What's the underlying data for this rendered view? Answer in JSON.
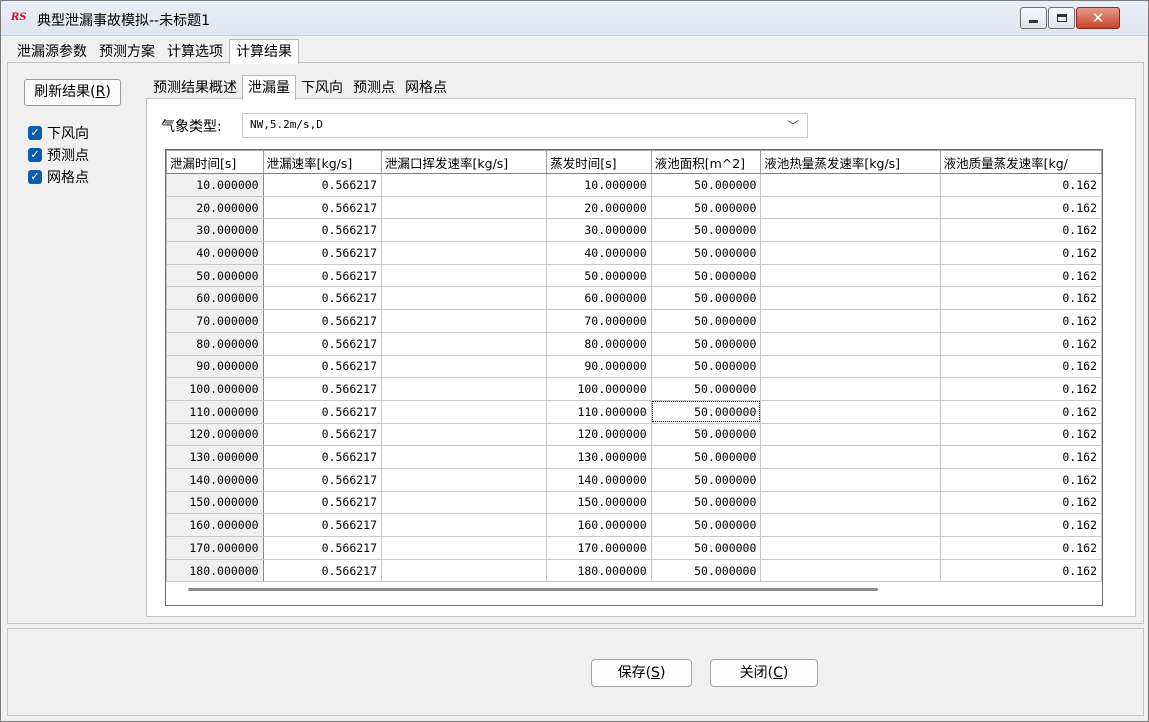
{
  "window": {
    "title": "典型泄漏事故模拟--未标题1",
    "app_icon": "RS"
  },
  "main_tabs": [
    "泄漏源参数",
    "预测方案",
    "计算选项",
    "计算结果"
  ],
  "active_main_tab": "计算结果",
  "left": {
    "refresh_label": "刷新结果(",
    "refresh_mnemonic": "R",
    "refresh_suffix": ")",
    "checkboxes": [
      {
        "label": "下风向",
        "checked": true
      },
      {
        "label": "预测点",
        "checked": true
      },
      {
        "label": "网格点",
        "checked": true
      }
    ]
  },
  "sub_tabs": [
    "预测结果概述",
    "泄漏量",
    "下风向",
    "预测点",
    "网格点"
  ],
  "active_sub_tab": "泄漏量",
  "weather": {
    "label": "气象类型:",
    "value": "NW,5.2m/s,D"
  },
  "table": {
    "headers": [
      "泄漏时间[s]",
      "泄漏速率[kg/s]",
      "泄漏口挥发速率[kg/s]",
      "蒸发时间[s]",
      "液池面积[m^2]",
      "液池热量蒸发速率[kg/s]",
      "液池质量蒸发速率[kg/"
    ],
    "rows": [
      [
        "10.000000",
        "0.566217",
        "",
        "10.000000",
        "50.000000",
        "",
        "0.162"
      ],
      [
        "20.000000",
        "0.566217",
        "",
        "20.000000",
        "50.000000",
        "",
        "0.162"
      ],
      [
        "30.000000",
        "0.566217",
        "",
        "30.000000",
        "50.000000",
        "",
        "0.162"
      ],
      [
        "40.000000",
        "0.566217",
        "",
        "40.000000",
        "50.000000",
        "",
        "0.162"
      ],
      [
        "50.000000",
        "0.566217",
        "",
        "50.000000",
        "50.000000",
        "",
        "0.162"
      ],
      [
        "60.000000",
        "0.566217",
        "",
        "60.000000",
        "50.000000",
        "",
        "0.162"
      ],
      [
        "70.000000",
        "0.566217",
        "",
        "70.000000",
        "50.000000",
        "",
        "0.162"
      ],
      [
        "80.000000",
        "0.566217",
        "",
        "80.000000",
        "50.000000",
        "",
        "0.162"
      ],
      [
        "90.000000",
        "0.566217",
        "",
        "90.000000",
        "50.000000",
        "",
        "0.162"
      ],
      [
        "100.000000",
        "0.566217",
        "",
        "100.000000",
        "50.000000",
        "",
        "0.162"
      ],
      [
        "110.000000",
        "0.566217",
        "",
        "110.000000",
        "50.000000",
        "",
        "0.162"
      ],
      [
        "120.000000",
        "0.566217",
        "",
        "120.000000",
        "50.000000",
        "",
        "0.162"
      ],
      [
        "130.000000",
        "0.566217",
        "",
        "130.000000",
        "50.000000",
        "",
        "0.162"
      ],
      [
        "140.000000",
        "0.566217",
        "",
        "140.000000",
        "50.000000",
        "",
        "0.162"
      ],
      [
        "150.000000",
        "0.566217",
        "",
        "150.000000",
        "50.000000",
        "",
        "0.162"
      ],
      [
        "160.000000",
        "0.566217",
        "",
        "160.000000",
        "50.000000",
        "",
        "0.162"
      ],
      [
        "170.000000",
        "0.566217",
        "",
        "170.000000",
        "50.000000",
        "",
        "0.162"
      ],
      [
        "180.000000",
        "0.566217",
        "",
        "180.000000",
        "50.000000",
        "",
        "0.162"
      ]
    ],
    "focused_row": 10,
    "focused_col": 4
  },
  "footer": {
    "save_label": "保存(",
    "save_mnemonic": "S",
    "close_label": "关闭(",
    "close_mnemonic": "C",
    "suffix": ")"
  }
}
